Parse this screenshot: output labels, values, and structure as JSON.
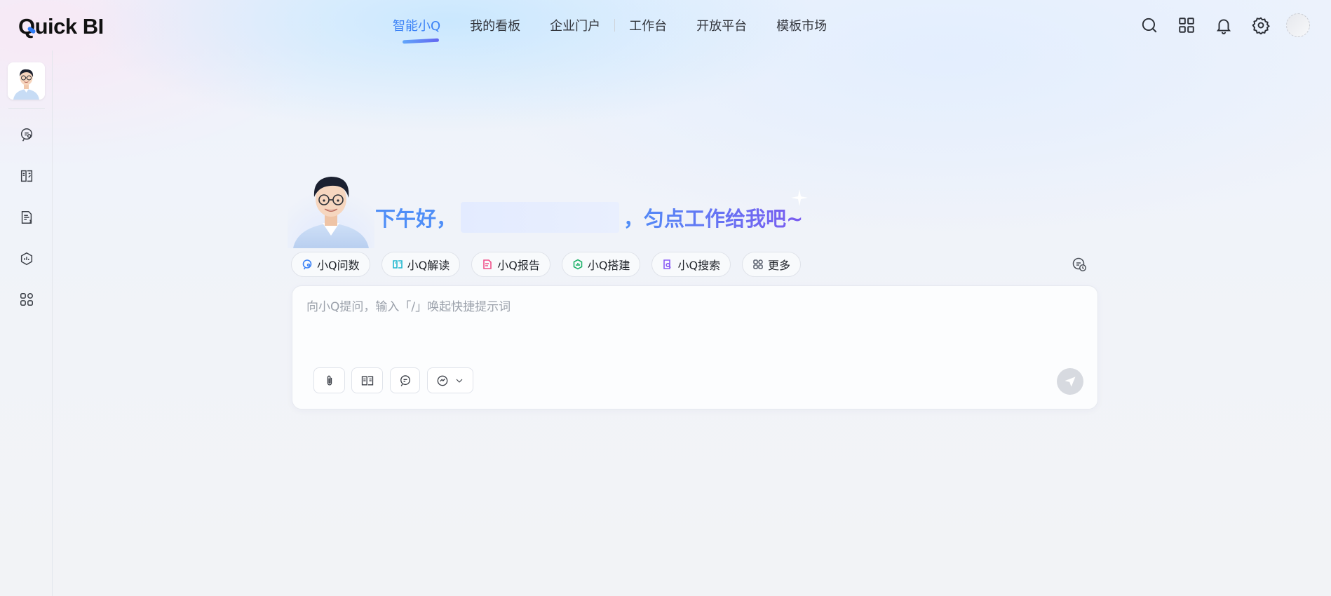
{
  "app": {
    "logo_text_prefix": "Q",
    "logo_text_rest": "uick BI"
  },
  "topnav": {
    "items": [
      {
        "label": "智能小Q",
        "active": true
      },
      {
        "label": "我的看板",
        "active": false
      },
      {
        "label": "企业门户",
        "active": false
      },
      {
        "label": "工作台",
        "active": false
      },
      {
        "label": "开放平台",
        "active": false
      },
      {
        "label": "模板市场",
        "active": false
      }
    ]
  },
  "header_icons": [
    "search-icon",
    "apps-grid-icon",
    "bell-icon",
    "settings-icon",
    "user-avatar"
  ],
  "sidebar": {
    "items": [
      {
        "name": "chat-icon"
      },
      {
        "name": "book-icon"
      },
      {
        "name": "report-icon"
      },
      {
        "name": "build-icon"
      },
      {
        "name": "more-apps-icon"
      }
    ]
  },
  "greeting": {
    "prefix": "下午好，",
    "suffix": "，匀点工作给我吧~"
  },
  "chips": [
    {
      "label": "小Q问数",
      "color": "#3b82f6"
    },
    {
      "label": "小Q解读",
      "color": "#22b8cf"
    },
    {
      "label": "小Q报告",
      "color": "#f0508a"
    },
    {
      "label": "小Q搭建",
      "color": "#20b26b"
    },
    {
      "label": "小Q搜索",
      "color": "#8b5cf6"
    },
    {
      "label": "更多",
      "color": "#5b6270"
    }
  ],
  "input": {
    "placeholder": "向小Q提问，输入「/」唤起快捷提示词",
    "value": ""
  },
  "colors": {
    "accent": "#3b82f6",
    "accent_purple": "#7b5cf0",
    "send_disabled": "#d7dae0"
  }
}
